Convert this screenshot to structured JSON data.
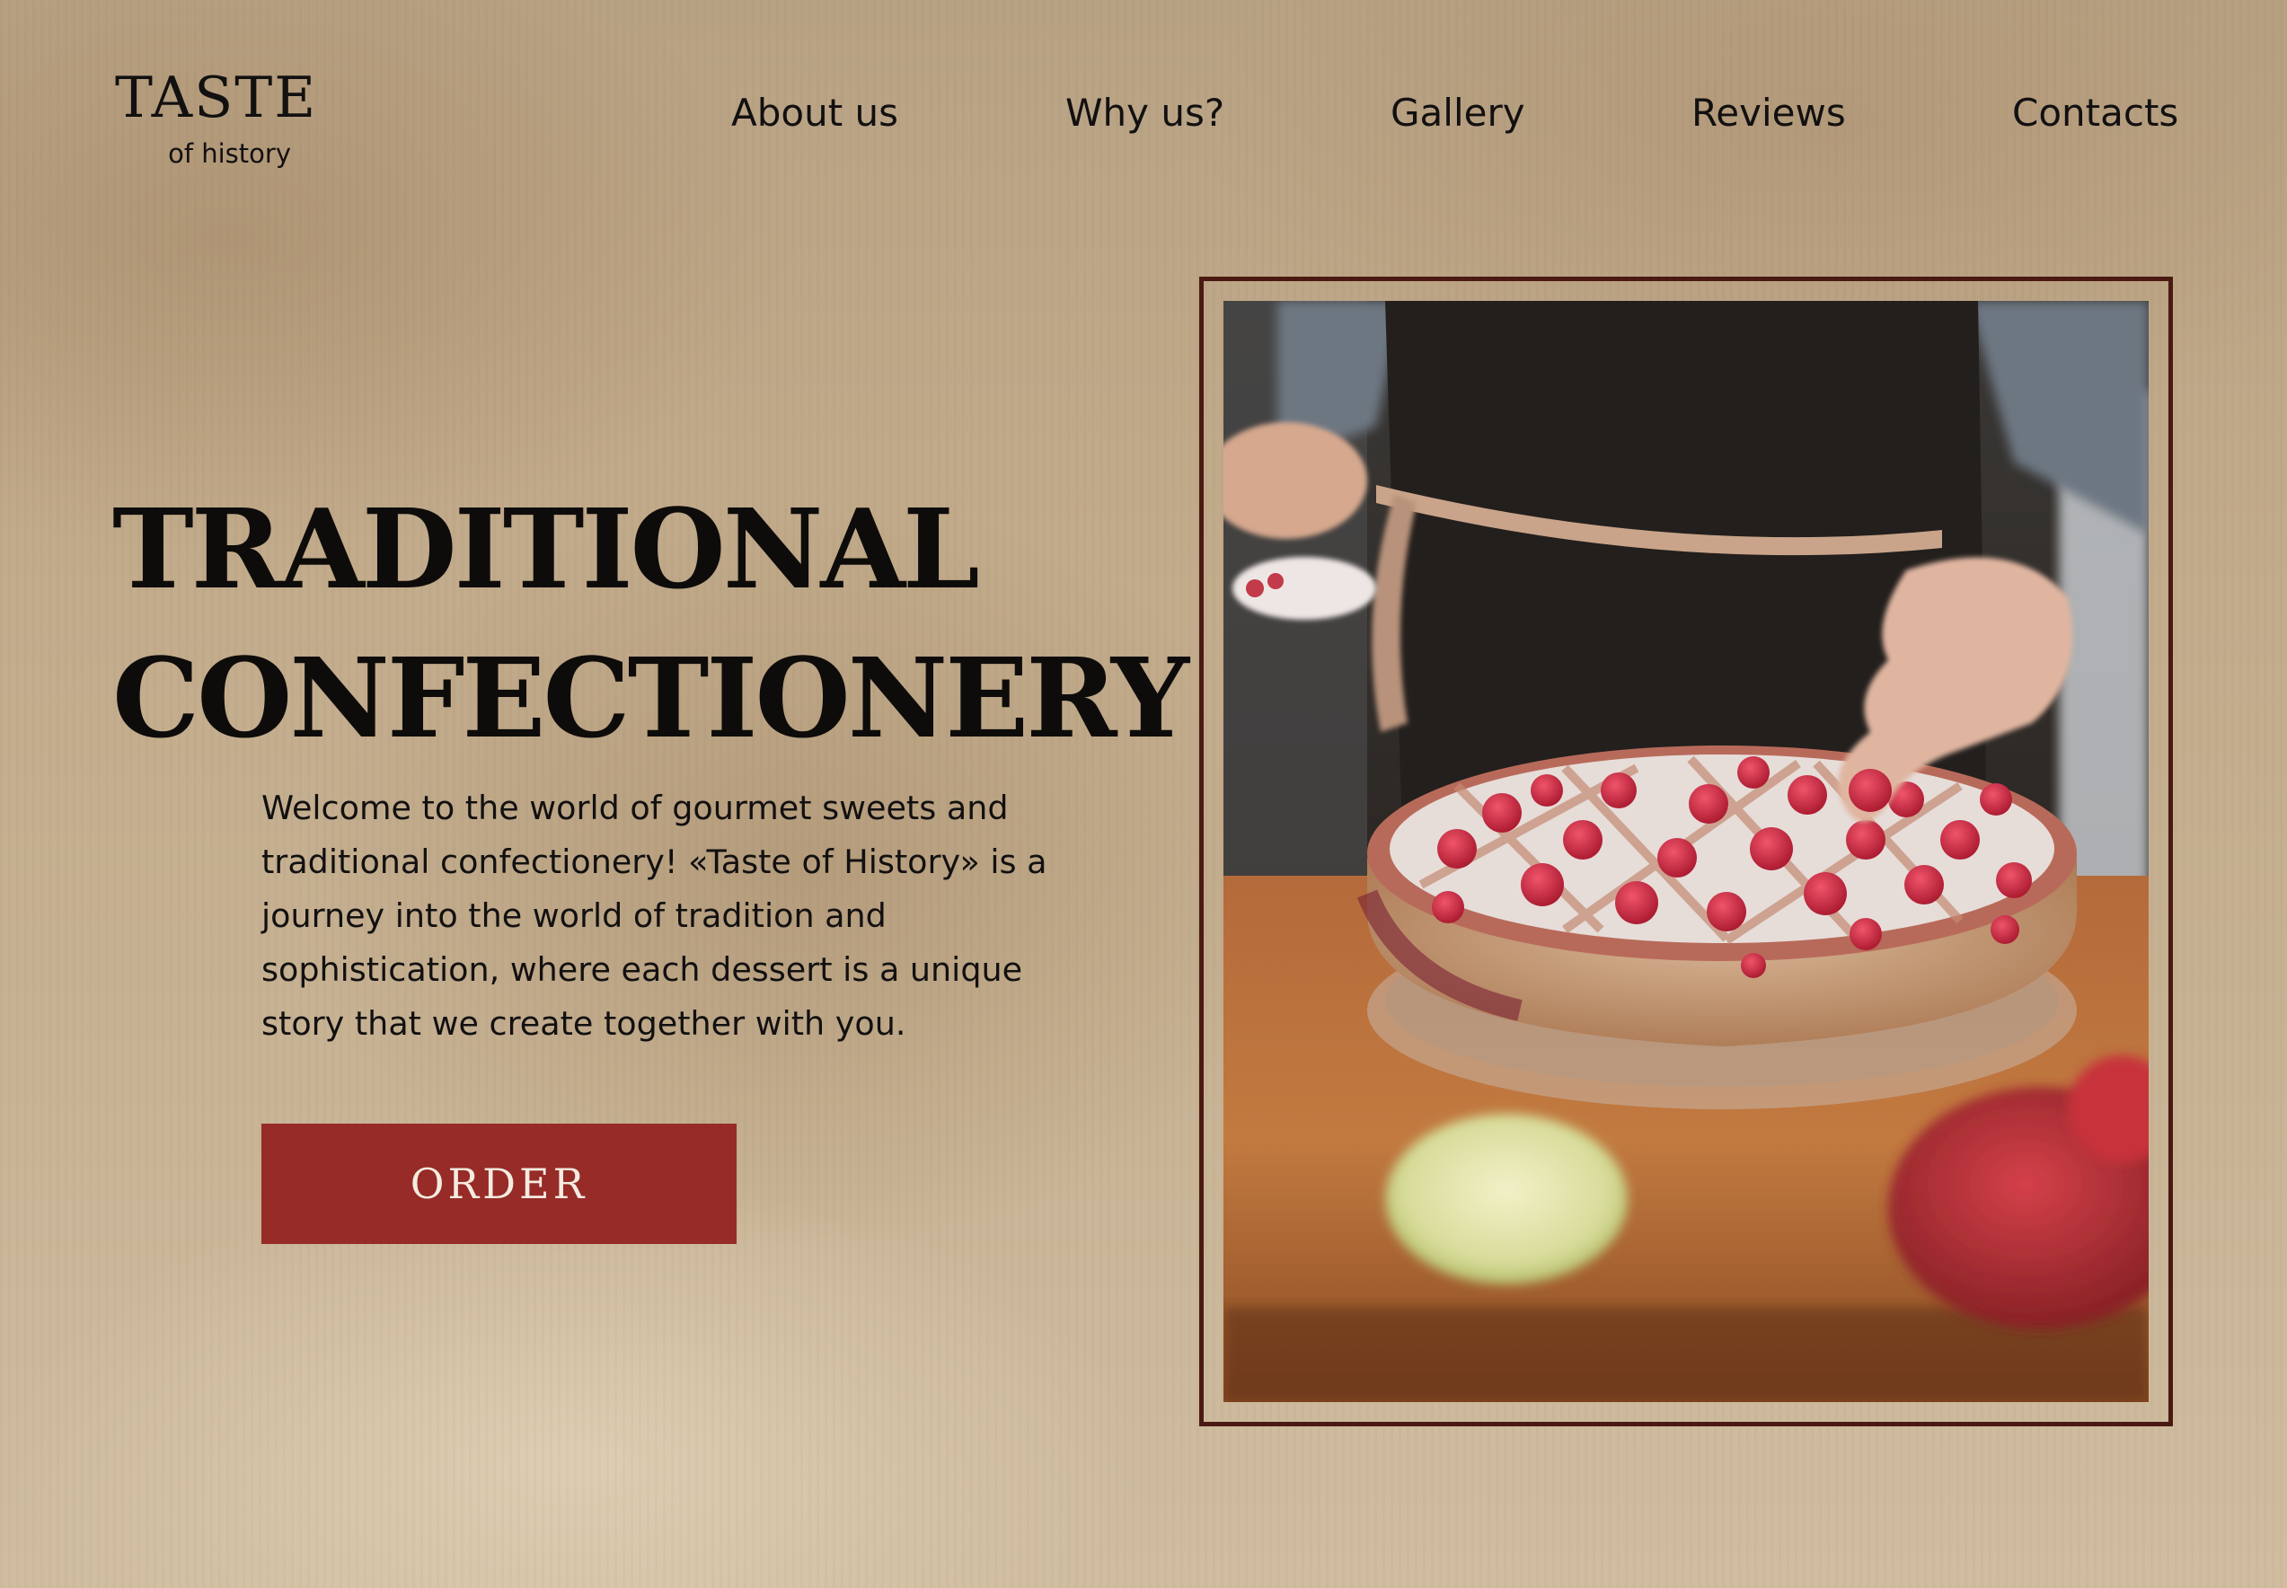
{
  "brand": {
    "title": "TASTE",
    "subtitle": "of history"
  },
  "nav": {
    "items": [
      {
        "label": "About us"
      },
      {
        "label": "Why us?"
      },
      {
        "label": "Gallery"
      },
      {
        "label": "Reviews"
      },
      {
        "label": "Contacts"
      }
    ]
  },
  "hero": {
    "title_line1": "TRADITIONAL",
    "title_line2": "CONFECTIONERY",
    "description": "Welcome to the world of gourmet sweets and traditional confectionery! «Taste of History» is a journey into the world of tradition and sophistication, where each dessert is a unique story that we create together with you.",
    "order_label": "ORDER"
  },
  "colors": {
    "accent_button": "#962b27",
    "frame_border": "#4a1a12",
    "text": "#121010"
  }
}
